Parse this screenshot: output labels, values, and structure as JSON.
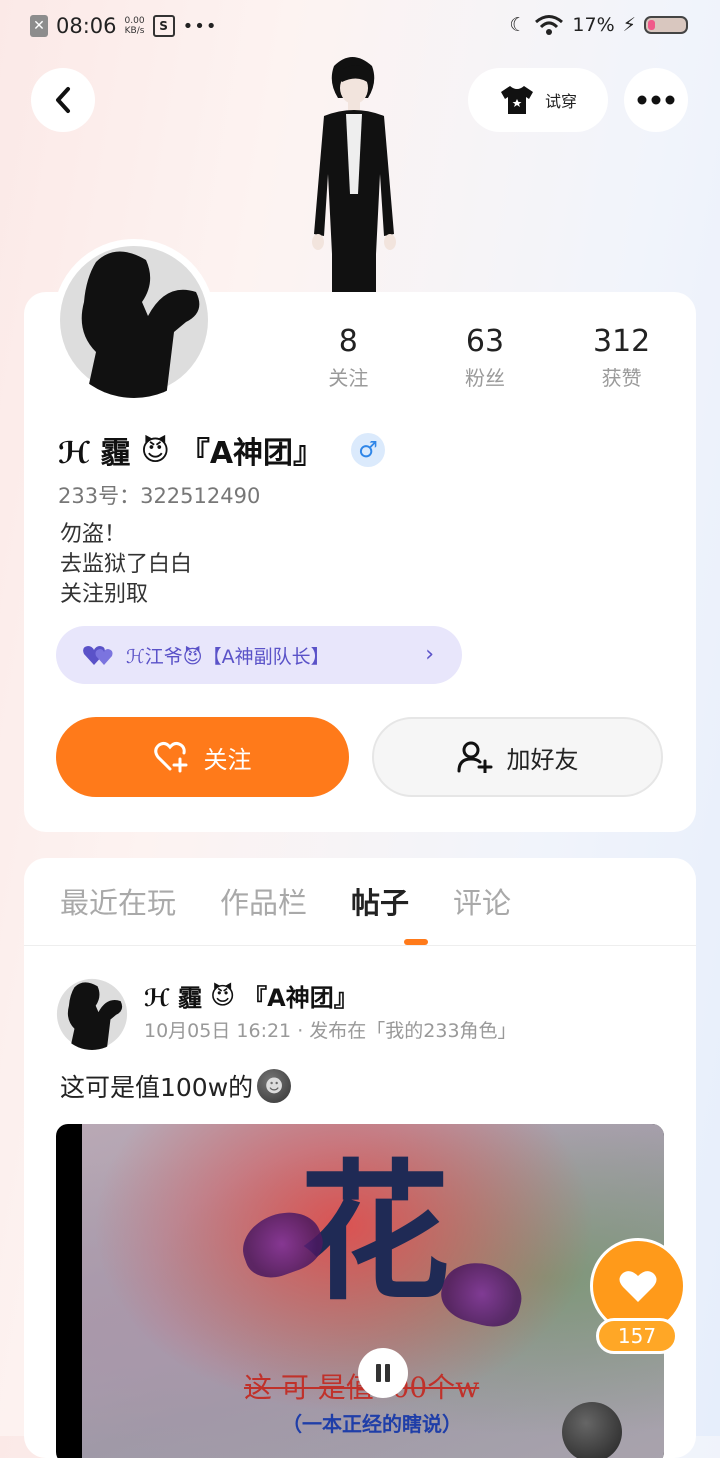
{
  "status_bar": {
    "time": "08:06",
    "net_speed_value": "0.00",
    "net_speed_unit": "KB/s",
    "dots": "•••",
    "battery_percent": "17%"
  },
  "header": {
    "tryon_label": "试穿"
  },
  "profile": {
    "stats": [
      {
        "value": "8",
        "label": "关注"
      },
      {
        "value": "63",
        "label": "粉丝"
      },
      {
        "value": "312",
        "label": "获赞"
      }
    ],
    "name_prefix": "ℋ 霾",
    "name_suffix": "『A神团』",
    "gender_symbol": "♂",
    "uid": "233号：322512490",
    "bio_lines": [
      "勿盗！",
      "去监狱了白白",
      "关注别取"
    ],
    "team_label": "ℋ江爷😈【A神副队长】",
    "follow_label": "关注",
    "add_friend_label": "加好友"
  },
  "feed": {
    "tabs": [
      {
        "label": "最近在玩",
        "active": false
      },
      {
        "label": "作品栏",
        "active": false
      },
      {
        "label": "帖子",
        "active": true
      },
      {
        "label": "评论",
        "active": false
      }
    ],
    "post": {
      "author_prefix": "ℋ 霾",
      "author_suffix": "『A神团』",
      "meta": "10月05日 16:21 · 发布在「我的233角色」",
      "text": "这可是值100w的",
      "media_big_char": "花",
      "media_caption": "这 可 是值100个w",
      "media_subcaption": "（一本正经的瞎说）"
    },
    "like_count": "157"
  },
  "colors": {
    "accent": "#ff7a1a",
    "gender_blue": "#2f86e8",
    "team_purple": "#5a52c8"
  }
}
